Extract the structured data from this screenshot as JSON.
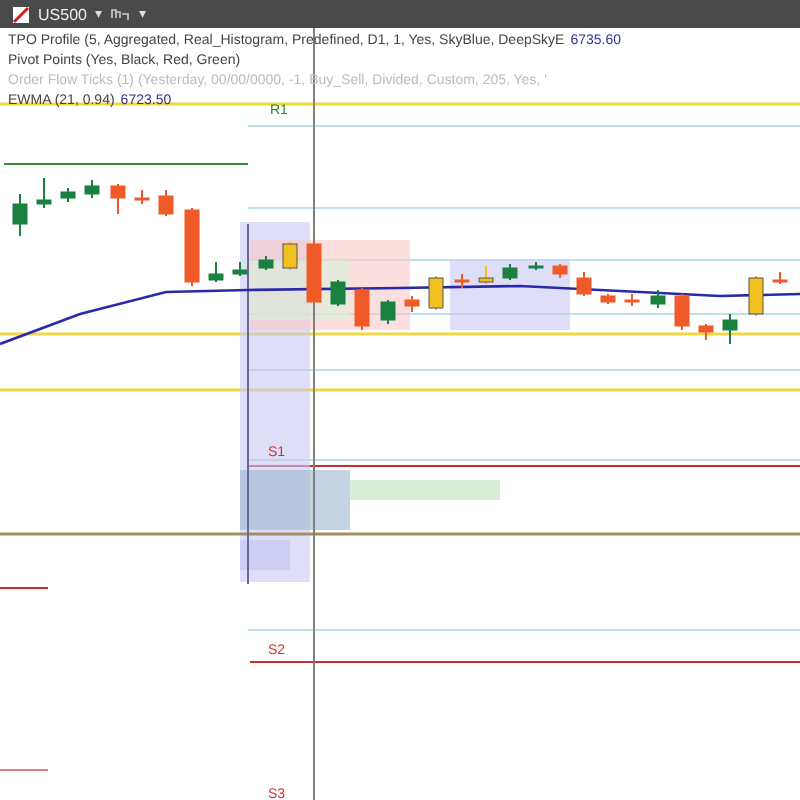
{
  "toolbar": {
    "symbol": "US500",
    "caret": "▾",
    "timeframe_caret": "▾"
  },
  "indicators": [
    {
      "label": "TPO Profile (5, Aggregated, Real_Histogram, Predefined, D1, 1, Yes, SkyBlue, DeepSkyE",
      "value": "6735.60",
      "kind": "normal"
    },
    {
      "label": "Pivot Points (Yes, Black, Red, Green)",
      "kind": "normal"
    },
    {
      "label": "Order Flow Ticks (1) (Yesterday, 00/00/0000, -1, Buy_Sell, Divided, Custom, 205, Yes, '",
      "kind": "faded"
    },
    {
      "label": "EWMA (21, 0.94)",
      "value": "6723.50",
      "kind": "normal"
    }
  ],
  "pivot_labels": [
    {
      "text": "R1",
      "kind": "resistance"
    },
    {
      "text": "S1",
      "kind": "support"
    },
    {
      "text": "S2",
      "kind": "support"
    },
    {
      "text": "S3",
      "kind": "support"
    }
  ]
}
